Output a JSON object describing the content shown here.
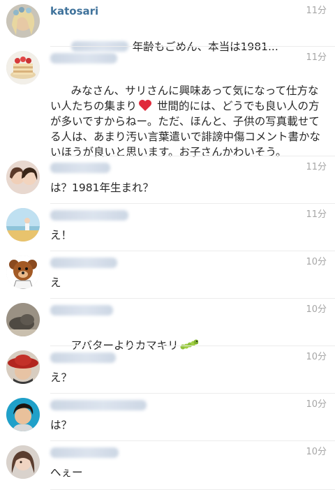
{
  "comments": [
    {
      "username": "katosari",
      "username_visible": true,
      "mention": true,
      "time": "11分",
      "text": "年齢もごめん、本当は1981...",
      "avatar": "blonde-woman-avatar"
    },
    {
      "username": "",
      "username_visible": false,
      "time": "11分",
      "text_before": "みなさん、サリさんに興味あって気になって仕方ない人たちの集まり",
      "emoji": "heart-icon",
      "text_after": " 世間的には、どうでも良い人の方が多いですからねー。ただ、ほんと、子供の写真載せてる人は、あまり汚い言葉遣いで誹謗中傷コメント書かないほうが良いと思います。お子さんかわいそう。",
      "avatar": "cake-avatar"
    },
    {
      "username": "",
      "username_visible": false,
      "time": "11分",
      "text": "は？1981年生まれ？",
      "avatar": "two-women-avatar"
    },
    {
      "username": "",
      "username_visible": false,
      "time": "11分",
      "text": "え！",
      "avatar": "beach-avatar"
    },
    {
      "username": "",
      "username_visible": false,
      "time": "10分",
      "text": "え",
      "avatar": "bear-avatar"
    },
    {
      "username": "",
      "username_visible": false,
      "time": "10分",
      "text_before": "アバターよりカマキリ",
      "emoji": "caterpillar-icon",
      "text_after": "",
      "avatar": "cat-avatar"
    },
    {
      "username": "",
      "username_visible": false,
      "time": "10分",
      "text": "え？",
      "avatar": "hat-person-avatar"
    },
    {
      "username": "",
      "username_visible": false,
      "time": "10分",
      "text": "は？",
      "avatar": "man-avatar"
    },
    {
      "username": "",
      "username_visible": false,
      "time": "10分",
      "text": "へぇー",
      "avatar": "woman-avatar"
    }
  ],
  "colors": {
    "username": "#3f729b",
    "time": "#a6a6a6",
    "text": "#262626",
    "divider": "#ececec"
  }
}
